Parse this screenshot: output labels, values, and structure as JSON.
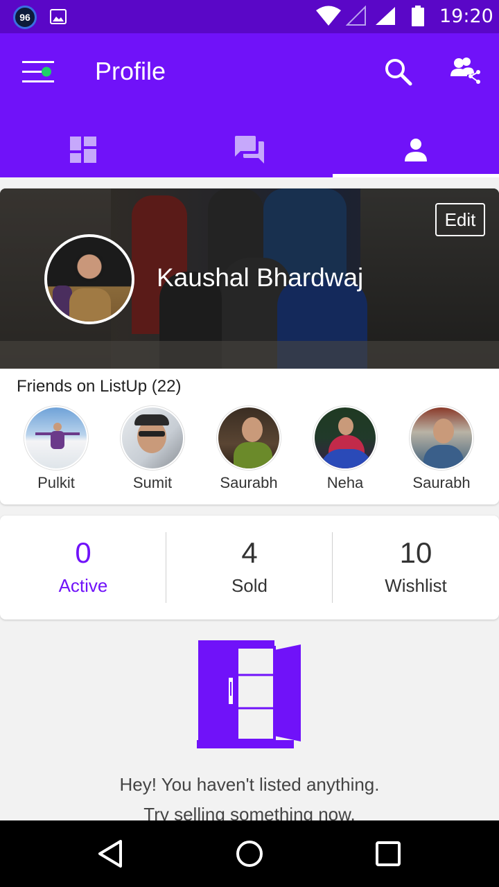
{
  "status_bar": {
    "badge": "96",
    "time": "19:20"
  },
  "app_bar": {
    "title": "Profile"
  },
  "profile": {
    "name": "Kaushal Bhardwaj",
    "edit_label": "Edit"
  },
  "friends": {
    "heading": "Friends on ListUp (22)",
    "items": [
      {
        "name": "Pulkit"
      },
      {
        "name": "Sumit"
      },
      {
        "name": "Saurabh"
      },
      {
        "name": "Neha"
      },
      {
        "name": "Saurabh"
      }
    ]
  },
  "stats": [
    {
      "value": "0",
      "label": "Active"
    },
    {
      "value": "4",
      "label": "Sold"
    },
    {
      "value": "10",
      "label": "Wishlist"
    }
  ],
  "empty_state": {
    "line1": "Hey! You haven't listed anything.",
    "line2": "Try selling something now."
  },
  "colors": {
    "primary": "#7012f9",
    "status_bar": "#5a07c7",
    "accent_dot": "#1fd06a"
  },
  "icons": {
    "menu": "menu-icon",
    "search": "search-icon",
    "friends": "friends-share-icon",
    "tab_dashboard": "dashboard-icon",
    "tab_chat": "chat-icon",
    "tab_profile": "person-icon"
  }
}
